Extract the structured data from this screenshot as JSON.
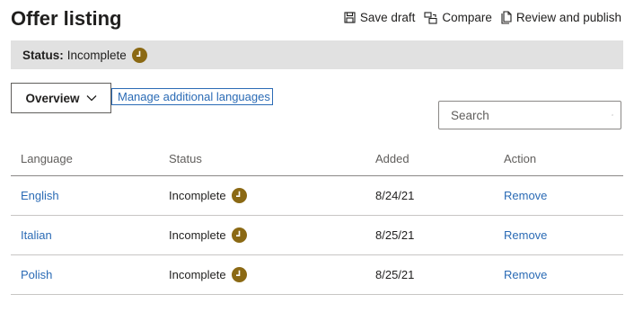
{
  "page": {
    "title": "Offer listing"
  },
  "toolbar": {
    "save_label": "Save draft",
    "compare_label": "Compare",
    "publish_label": "Review and publish"
  },
  "status": {
    "label": "Status:",
    "value": "Incomplete",
    "icon": "clock-icon",
    "icon_color": "#8b6914"
  },
  "controls": {
    "overview_label": "Overview",
    "manage_link": "Manage additional languages",
    "search_placeholder": "Search"
  },
  "table": {
    "headers": [
      "Language",
      "Status",
      "Added",
      "Action"
    ],
    "rows": [
      {
        "language": "English",
        "status": "Incomplete",
        "added": "8/24/21",
        "action": "Remove"
      },
      {
        "language": "Italian",
        "status": "Incomplete",
        "added": "8/25/21",
        "action": "Remove"
      },
      {
        "language": "Polish",
        "status": "Incomplete",
        "added": "8/25/21",
        "action": "Remove"
      }
    ]
  },
  "colors": {
    "link": "#2b6bb5",
    "status_bar": "#e1e1e1",
    "status_icon": "#8b6914"
  }
}
